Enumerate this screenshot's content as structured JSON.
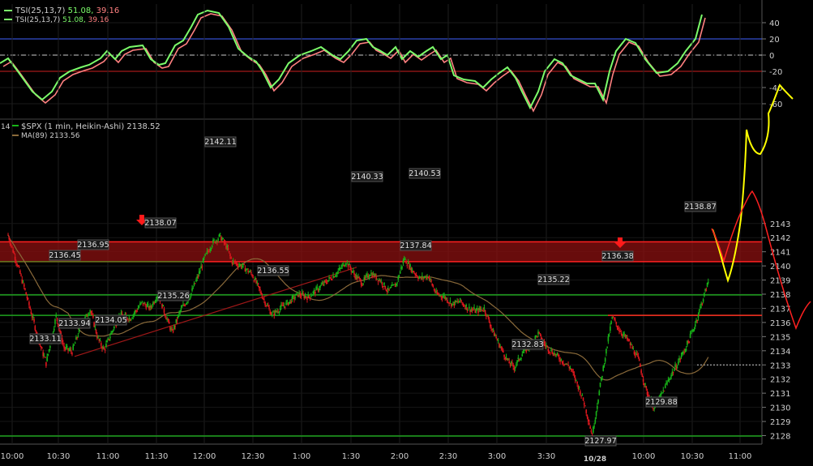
{
  "tsi_panel": {
    "legend": [
      {
        "text": "TSI(25,13,7)",
        "v1": "51.08,",
        "v2": "39.16"
      },
      {
        "text": "TSI(25,13,7)",
        "v1": "51.08,",
        "v2": "39.16"
      }
    ],
    "y_ticks": [
      "40",
      "20",
      "0",
      "-20",
      "-40",
      "-60"
    ]
  },
  "price_panel": {
    "header_corner": "14",
    "legend": [
      {
        "text": "$SPX (1 min, Heikin-Ashi) 2138.52"
      },
      {
        "text": "MA(89) 2133.56"
      }
    ],
    "y_ticks": [
      "2143",
      "2142",
      "2141",
      "2140",
      "2139",
      "2138",
      "2137",
      "2136",
      "2135",
      "2134",
      "2133",
      "2132",
      "2131",
      "2130",
      "2129",
      "2128"
    ]
  },
  "x_axis": {
    "ticks": [
      "10:00",
      "10:30",
      "11:00",
      "11:30",
      "12:00",
      "12:30",
      "1:00",
      "1:30",
      "2:00",
      "2:30",
      "3:00",
      "3:30",
      "10:00",
      "10:30",
      "11:00"
    ],
    "date_label": "10/28"
  },
  "price_labels": [
    "2142.11",
    "2140.33",
    "2140.53",
    "2138.87",
    "2138.07",
    "2136.95",
    "2136.45",
    "2136.38",
    "2136.55",
    "2135.22",
    "2135.26",
    "2133.94",
    "2134.05",
    "2133.11",
    "2132.83",
    "2129.88",
    "2127.97",
    "2137.84"
  ],
  "colors": {
    "background": "#000000",
    "up_candle": "#18b418",
    "down_candle": "#e0181e",
    "tsi_fast": "#7CFC6A",
    "tsi_slow": "#ff8080",
    "ma_line": "#8a6a3a",
    "support_line": "#1fa31f",
    "resistance_band": "#8b1010",
    "annotation_yellow": "#ffff00",
    "annotation_red": "#ff2020",
    "zero_line": "#cccccc",
    "level_20_line": "#4060ff",
    "level_neg20_line": "#cc2020"
  },
  "icons": [
    "down-arrow-marker-icon",
    "down-arrow-marker-icon"
  ],
  "chart_data": [
    {
      "type": "line",
      "title": "TSI(25,13,7)",
      "series": [
        {
          "name": "TSI(25,13,7)",
          "last": 51.08
        },
        {
          "name": "TSI(25,13,7) signal",
          "last": 39.16
        }
      ],
      "ylim": [
        -65,
        60
      ],
      "reference_lines": [
        20,
        0,
        -20
      ],
      "y_ticks": [
        40,
        20,
        0,
        -20,
        -40,
        -60
      ]
    },
    {
      "type": "candlestick",
      "title": "$SPX (1 min, Heikin-Ashi) 2138.52",
      "ma": {
        "name": "MA(89)",
        "last": 2133.56
      },
      "ylim": [
        2127.7,
        2143.6
      ],
      "horizontal_lines": [
        2137.95,
        2136.5,
        2127.97
      ],
      "resistance_band": [
        2140.3,
        2141.7
      ],
      "dotted_last_line": 2133.0,
      "x_ticks": [
        "10:00",
        "10:30",
        "11:00",
        "11:30",
        "12:00",
        "12:30",
        "1:00",
        "1:30",
        "2:00",
        "2:30",
        "3:00",
        "3:30",
        "10:00",
        "10:30",
        "11:00"
      ],
      "close_path": [
        [
          0,
          2142.2
        ],
        [
          8,
          2140.4
        ],
        [
          18,
          2138.0
        ],
        [
          30,
          2134.9
        ],
        [
          38,
          2133.11
        ],
        [
          48,
          2136.45
        ],
        [
          56,
          2134.2
        ],
        [
          64,
          2133.94
        ],
        [
          72,
          2135.6
        ],
        [
          82,
          2136.95
        ],
        [
          90,
          2134.8
        ],
        [
          96,
          2134.05
        ],
        [
          104,
          2135.4
        ],
        [
          112,
          2136.5
        ],
        [
          122,
          2136.3
        ],
        [
          134,
          2137.4
        ],
        [
          142,
          2137.0
        ],
        [
          150,
          2138.07
        ],
        [
          158,
          2136.4
        ],
        [
          164,
          2135.26
        ],
        [
          172,
          2136.8
        ],
        [
          182,
          2137.9
        ],
        [
          190,
          2139.3
        ],
        [
          196,
          2140.5
        ],
        [
          204,
          2141.6
        ],
        [
          212,
          2142.11
        ],
        [
          218,
          2141.4
        ],
        [
          224,
          2140.3
        ],
        [
          234,
          2140.0
        ],
        [
          244,
          2139.4
        ],
        [
          252,
          2138.2
        ],
        [
          258,
          2137.3
        ],
        [
          264,
          2136.55
        ],
        [
          272,
          2137.0
        ],
        [
          280,
          2137.4
        ],
        [
          290,
          2138.0
        ],
        [
          300,
          2137.8
        ],
        [
          310,
          2138.4
        ],
        [
          320,
          2139.0
        ],
        [
          330,
          2139.6
        ],
        [
          338,
          2140.33
        ],
        [
          346,
          2139.4
        ],
        [
          354,
          2138.8
        ],
        [
          362,
          2139.5
        ],
        [
          372,
          2139.0
        ],
        [
          380,
          2138.2
        ],
        [
          388,
          2138.7
        ],
        [
          396,
          2140.53
        ],
        [
          404,
          2139.7
        ],
        [
          412,
          2139.1
        ],
        [
          420,
          2139.3
        ],
        [
          428,
          2138.0
        ],
        [
          436,
          2137.84
        ],
        [
          444,
          2137.3
        ],
        [
          452,
          2137.5
        ],
        [
          460,
          2137.0
        ],
        [
          468,
          2136.8
        ],
        [
          476,
          2137.0
        ],
        [
          484,
          2135.5
        ],
        [
          492,
          2134.3
        ],
        [
          500,
          2133.2
        ],
        [
          506,
          2132.83
        ],
        [
          514,
          2133.8
        ],
        [
          522,
          2134.4
        ],
        [
          530,
          2135.22
        ],
        [
          538,
          2134.3
        ],
        [
          546,
          2133.8
        ],
        [
          554,
          2133.3
        ],
        [
          562,
          2132.8
        ],
        [
          570,
          2131.5
        ],
        [
          576,
          2130.3
        ],
        [
          580,
          2129.2
        ],
        [
          584,
          2127.97
        ],
        [
          590,
          2130.7
        ],
        [
          596,
          2133.2
        ],
        [
          604,
          2136.38
        ],
        [
          612,
          2135.4
        ],
        [
          620,
          2134.7
        ],
        [
          630,
          2133.4
        ],
        [
          638,
          2131.2
        ],
        [
          646,
          2129.88
        ],
        [
          654,
          2131.0
        ],
        [
          662,
          2132.2
        ],
        [
          670,
          2133.2
        ],
        [
          678,
          2134.3
        ],
        [
          686,
          2135.7
        ],
        [
          694,
          2137.5
        ],
        [
          700,
          2138.87
        ]
      ]
    }
  ]
}
